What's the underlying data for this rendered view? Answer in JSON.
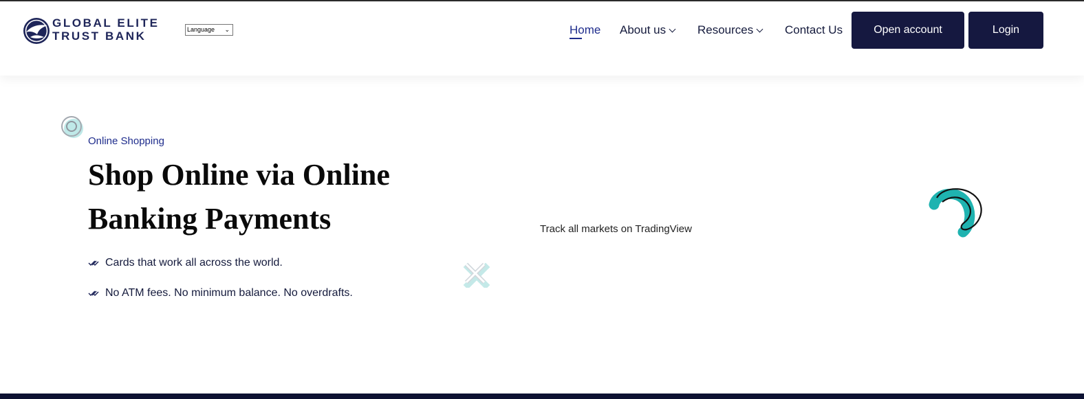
{
  "brand": {
    "logo_line1": "GLOBAL ELITE",
    "logo_line2": "TRUST BANK",
    "logo_icon": "eagle-globe-icon",
    "color": "#1e2559"
  },
  "language_select": {
    "value": "Language"
  },
  "nav": {
    "home": "Home",
    "about": "About us",
    "resources": "Resources",
    "contact": "Contact Us",
    "open_account": "Open account",
    "login": "Login"
  },
  "hero": {
    "eyebrow": "Online Shopping",
    "headline": "Shop Online via Online Banking Payments",
    "features": [
      "Cards that work all across the world.",
      "No ATM fees. No minimum balance. No overdrafts."
    ],
    "tradingview_text": "Track all markets on TradingView"
  },
  "colors": {
    "primary_button": "#151840",
    "accent_teal": "#1fb3b0",
    "nav_active": "#1e2c8c"
  }
}
